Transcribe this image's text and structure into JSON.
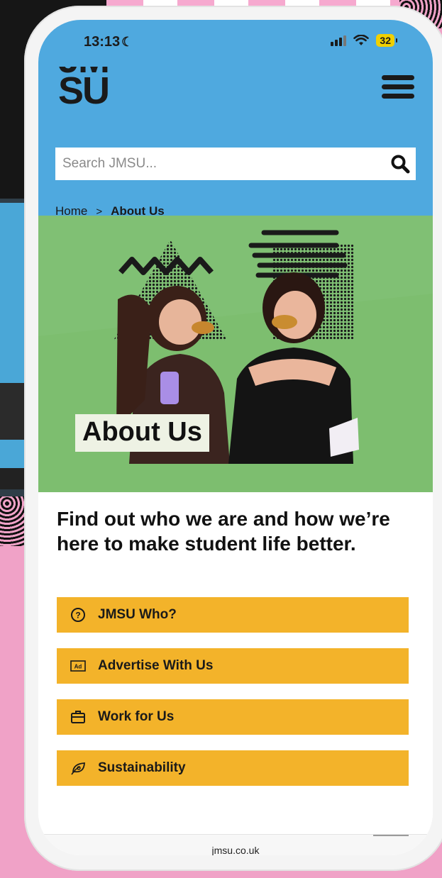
{
  "status_bar": {
    "time": "13:13",
    "battery": "32"
  },
  "header": {
    "logo_top": "JM",
    "logo": "SU",
    "search": {
      "placeholder": "Search JMSU..."
    }
  },
  "breadcrumb": {
    "home": "Home",
    "separator": ">",
    "current": "About Us"
  },
  "hero": {
    "title": "About Us"
  },
  "content": {
    "headline": "Find out who we are and how we’re here to make student life better.",
    "buttons": [
      {
        "label": "JMSU Who?",
        "icon": "question-circle-icon"
      },
      {
        "label": "Advertise With Us",
        "icon": "ad-icon"
      },
      {
        "label": "Work for Us",
        "icon": "briefcase-icon"
      },
      {
        "label": "Sustainability",
        "icon": "leaf-icon"
      }
    ]
  },
  "browser": {
    "url": "jmsu.co.uk"
  },
  "colors": {
    "header_blue": "#4fa9df",
    "hero_green": "#80c074",
    "button_yellow": "#f3b32a",
    "background_pink": "#f0a2c7"
  }
}
